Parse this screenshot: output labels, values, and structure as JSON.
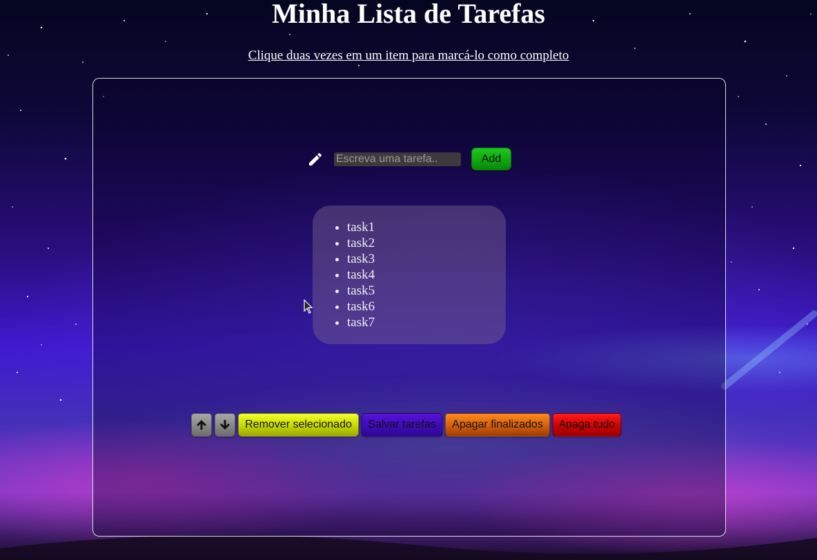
{
  "header": {
    "title": "Minha Lista de Tarefas",
    "instruction": "Clique duas vezes em um item para marcá-lo como completo"
  },
  "input": {
    "placeholder": "Escreva uma tarefa..",
    "value": "",
    "icon": "pencil-icon",
    "add_label": "Add"
  },
  "tasks": [
    {
      "label": "task1"
    },
    {
      "label": "task2"
    },
    {
      "label": "task3"
    },
    {
      "label": "task4"
    },
    {
      "label": "task5"
    },
    {
      "label": "task6"
    },
    {
      "label": "task7"
    }
  ],
  "toolbar": {
    "move_up_icon": "arrow-up-icon",
    "move_down_icon": "arrow-down-icon",
    "remove_selected_label": "Remover selecionado",
    "save_label": "Salvar tarefas",
    "clear_done_label": "Apagar finalizados",
    "clear_all_label": "Apaga tudo"
  },
  "colors": {
    "add_button": "#0ea50e",
    "remove_selected": "#c5d600",
    "save": "#3d0bb8",
    "clear_done": "#d45e0a",
    "clear_all": "#cf0000",
    "arrow_buttons": "#8a8a8a"
  }
}
